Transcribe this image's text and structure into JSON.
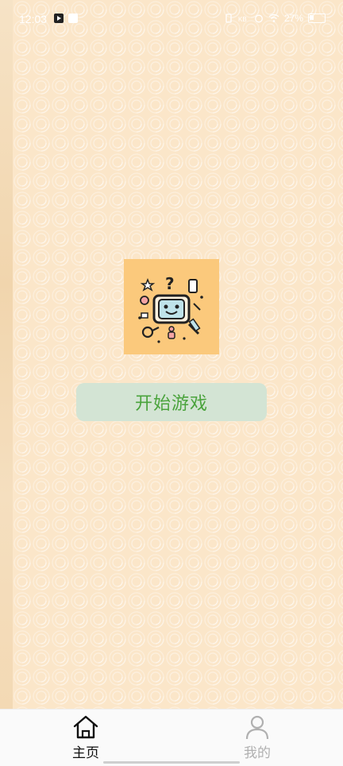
{
  "status_bar": {
    "time": "12:03",
    "battery_text": "27%",
    "icons": [
      "media-play-icon",
      "mail-icon",
      "vibrate-icon",
      "data-speed-icon",
      "alarm-icon",
      "wifi-icon",
      "battery-icon"
    ]
  },
  "main": {
    "start_button_label": "开始游戏",
    "app_icon": "game-robot-logo-icon"
  },
  "bottom_nav": {
    "items": [
      {
        "label": "主页",
        "icon": "home-icon",
        "active": true
      },
      {
        "label": "我的",
        "icon": "person-icon",
        "active": false
      }
    ]
  },
  "colors": {
    "background": "#fbe6c9",
    "start_button_bg": "#d3e4d4",
    "start_button_text": "#4aa33c",
    "app_icon_bg": "#fbc97c",
    "nav_active": "#111111",
    "nav_inactive": "#b0b0b0"
  }
}
